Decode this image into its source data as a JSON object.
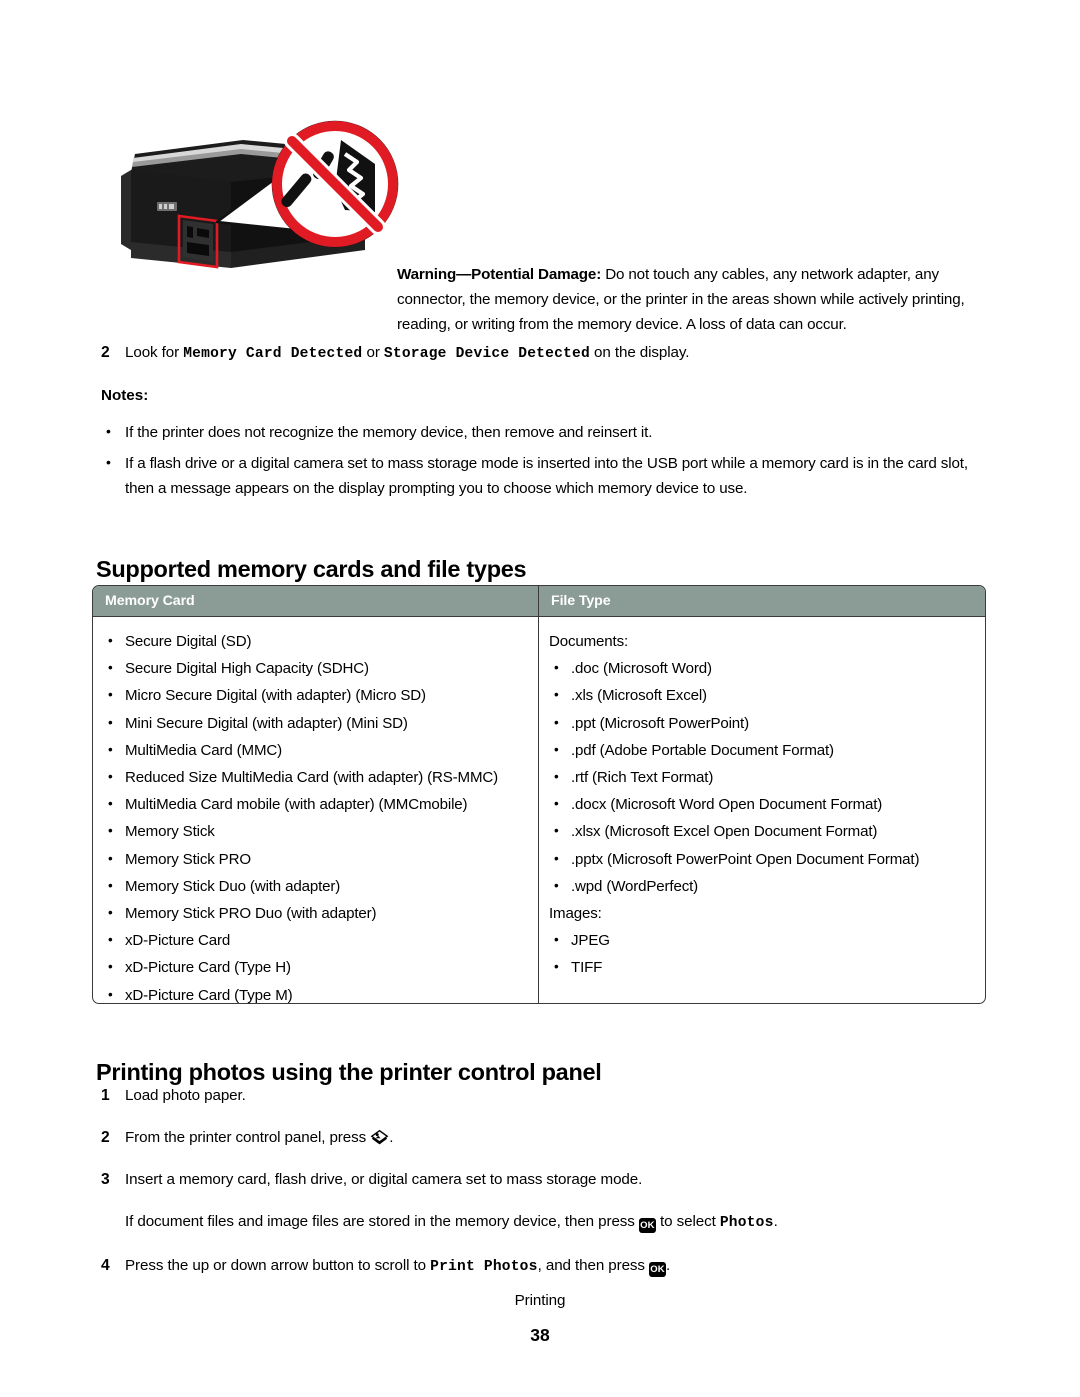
{
  "illustration": {
    "name": "printer-card-slot-no-touch-illustration",
    "alt": "Printer front corner with memory card slots highlighted in red and a red no-touch prohibition symbol over a hand"
  },
  "warning": {
    "lead": "Warning—Potential Damage:",
    "text": " Do not touch any cables, any network adapter, any connector, the memory device, or the printer in the areas shown while actively printing, reading, or writing from the memory device. A loss of data can occur."
  },
  "step_two_top": {
    "number": "2",
    "before": "Look for ",
    "mono_1": "Memory Card Detected",
    "middle": " or ",
    "mono_2": "Storage Device Detected",
    "after": " on the display."
  },
  "notes": {
    "label": "Notes:",
    "items": [
      "If the printer does not recognize the memory device, then remove and reinsert it.",
      "If a flash drive or a digital camera set to mass storage mode is inserted into the USB port while a memory card is in the card slot, then a message appears on the display prompting you to choose which memory device to use."
    ]
  },
  "headings": {
    "supported_cards": "Supported memory cards and file types",
    "printing_photos": "Printing photos using the printer control panel"
  },
  "table": {
    "columns": [
      "Memory Card",
      "File Type"
    ],
    "header_bg": "#8b9b96",
    "header_text_color": "#ffffff",
    "memory_cards": [
      "Secure Digital (SD)",
      "Secure Digital High Capacity (SDHC)",
      "Micro Secure Digital (with adapter) (Micro SD)",
      "Mini Secure Digital (with adapter) (Mini SD)",
      "MultiMedia Card (MMC)",
      "Reduced Size MultiMedia Card (with adapter) (RS-MMC)",
      "MultiMedia Card mobile (with adapter) (MMCmobile)",
      "Memory Stick",
      "Memory Stick PRO",
      "Memory Stick Duo (with adapter)",
      "Memory Stick PRO Duo (with adapter)",
      "xD-Picture Card",
      "xD-Picture Card (Type H)",
      "xD-Picture Card (Type M)"
    ],
    "file_types": {
      "documents_label": "Documents:",
      "documents": [
        ".doc (Microsoft Word)",
        ".xls (Microsoft Excel)",
        ".ppt (Microsoft PowerPoint)",
        ".pdf (Adobe Portable Document Format)",
        ".rtf (Rich Text Format)",
        ".docx (Microsoft Word Open Document Format)",
        ".xlsx (Microsoft Excel Open Document Format)",
        ".pptx (Microsoft PowerPoint Open Document Format)",
        ".wpd (WordPerfect)"
      ],
      "images_label": "Images:",
      "images": [
        "JPEG",
        "TIFF"
      ]
    }
  },
  "printing_steps": {
    "step1": {
      "number": "1",
      "text": "Load photo paper."
    },
    "step2": {
      "number": "2",
      "before": "From the printer control panel, press ",
      "icon": "photo-button-icon",
      "after": "."
    },
    "step3": {
      "number": "3",
      "text": "Insert a memory card, flash drive, or digital camera set to mass storage mode."
    },
    "step3_sub": {
      "before": "If document files and image files are stored in the memory device, then press ",
      "icon": "ok-button-icon",
      "icon_label": "OK",
      "middle": " to select ",
      "mono": "Photos",
      "after": "."
    },
    "step4": {
      "number": "4",
      "before": "Press the up or down arrow button to scroll to ",
      "mono": "Print Photos",
      "middle": ", and then press ",
      "icon": "ok-button-icon",
      "icon_label": "OK",
      "after": "."
    }
  },
  "footer": {
    "section": "Printing",
    "page_number": "38"
  }
}
